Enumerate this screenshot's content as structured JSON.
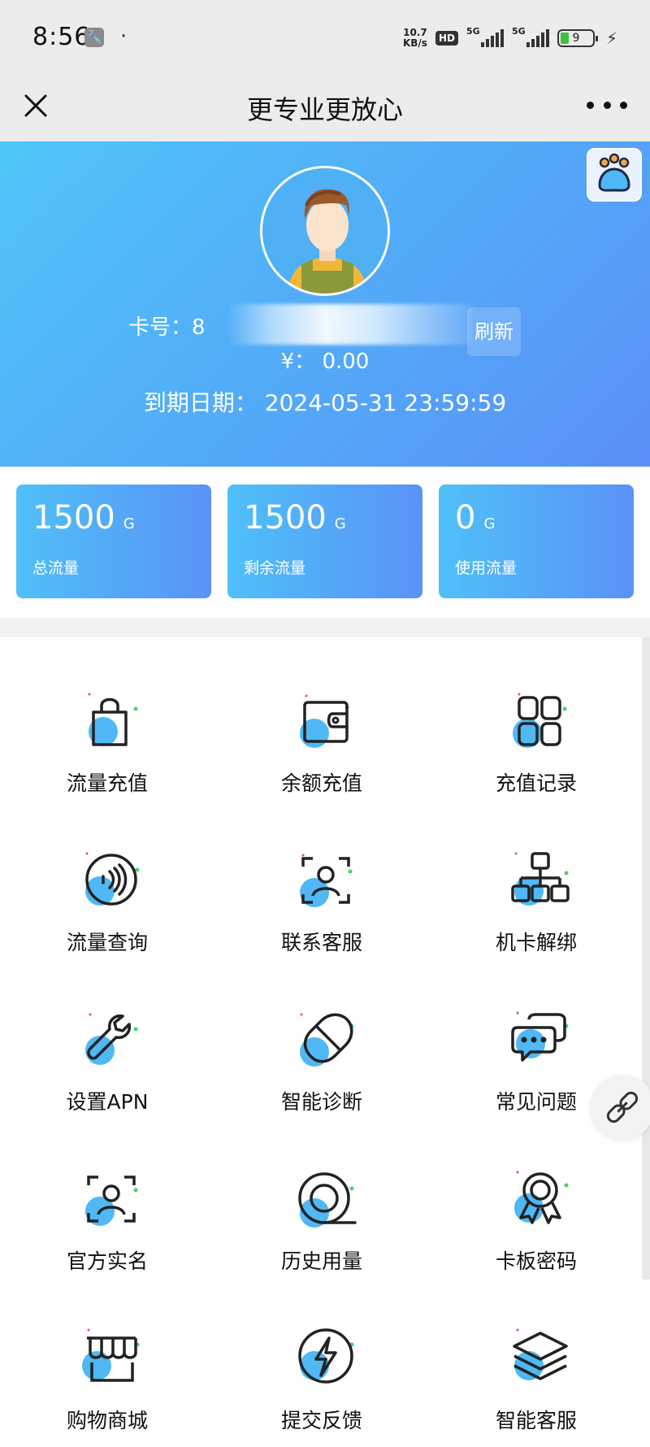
{
  "status_bar": {
    "time": "8:56",
    "dot": "·",
    "net_speed_value": "10.7",
    "net_speed_unit": "KB/s",
    "hd_label": "HD",
    "signal1_label": "5G",
    "signal2_label": "5G",
    "battery_level": "9"
  },
  "title_bar": {
    "title": "更专业更放心"
  },
  "hero": {
    "card_label": "卡号：8",
    "refresh_label": "刷新",
    "balance": "¥：  0.00",
    "expiry": "到期日期：  2024-05-31 23:59:59"
  },
  "stats": [
    {
      "value": "1500",
      "unit": "G",
      "label": "总流量"
    },
    {
      "value": "1500",
      "unit": "G",
      "label": "剩余流量"
    },
    {
      "value": "0",
      "unit": "G",
      "label": "使用流量"
    }
  ],
  "menu": [
    {
      "label": "流量充值",
      "icon": "shopping-bag-icon"
    },
    {
      "label": "余额充值",
      "icon": "wallet-icon"
    },
    {
      "label": "充值记录",
      "icon": "grid-icon"
    },
    {
      "label": "流量查询",
      "icon": "nfc-icon"
    },
    {
      "label": "联系客服",
      "icon": "face-scan-icon"
    },
    {
      "label": "机卡解绑",
      "icon": "hierarchy-icon"
    },
    {
      "label": "设置APN",
      "icon": "wrench-icon"
    },
    {
      "label": "智能诊断",
      "icon": "pill-icon"
    },
    {
      "label": "常见问题",
      "icon": "chat-icon"
    },
    {
      "label": "官方实名",
      "icon": "id-scan-icon"
    },
    {
      "label": "历史用量",
      "icon": "tape-icon"
    },
    {
      "label": "卡板密码",
      "icon": "award-icon"
    },
    {
      "label": "购物商城",
      "icon": "store-icon"
    },
    {
      "label": "提交反馈",
      "icon": "lightning-icon"
    },
    {
      "label": "智能客服",
      "icon": "layers-icon"
    }
  ],
  "colors": {
    "accent": "#4fb8f5",
    "hero_start": "#4fc6f7",
    "hero_end": "#5a8ff7",
    "icon_stroke": "#222222"
  }
}
